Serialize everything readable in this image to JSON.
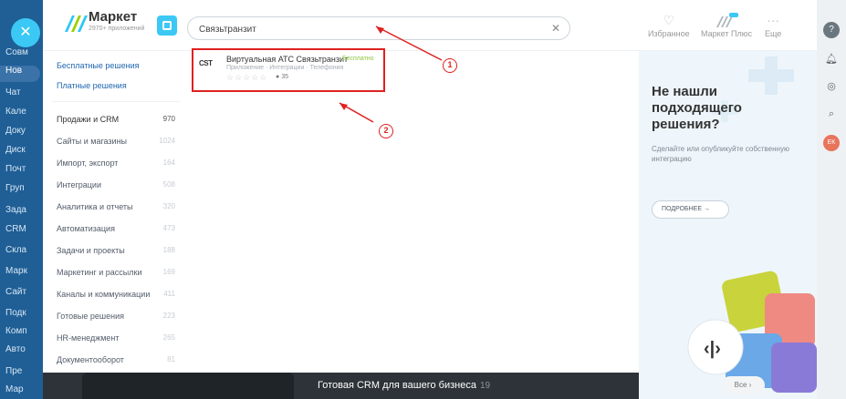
{
  "app_menu": [
    "Совм",
    "Нов",
    "Чат",
    "Кале",
    "Доку",
    "Диск",
    "Почт",
    "Груп",
    "Зада",
    "CRM",
    "Скла",
    "Марк",
    "Сайт",
    "Подк",
    "Комп",
    "Авто",
    "Пре",
    "Мар"
  ],
  "app_menu_active": 1,
  "header": {
    "logo_title": "Маркет",
    "logo_sub": "2970+ приложений",
    "search_value": "Связьтранзит",
    "links": [
      {
        "label": "Избранное",
        "icon": "heart-icon"
      },
      {
        "label": "Маркет Плюс",
        "icon": "market-plus-icon"
      },
      {
        "label": "Еще",
        "icon": "more-icon"
      }
    ]
  },
  "sidebar": {
    "links": [
      "Бесплатные решения",
      "Платные решения"
    ],
    "categories": [
      {
        "label": "Продажи и CRM",
        "count": "970"
      },
      {
        "label": "Сайты и магазины",
        "count": "1024"
      },
      {
        "label": "Импорт, экспорт",
        "count": "164"
      },
      {
        "label": "Интеграции",
        "count": "508"
      },
      {
        "label": "Аналитика и отчеты",
        "count": "320"
      },
      {
        "label": "Автоматизация",
        "count": "473"
      },
      {
        "label": "Задачи и проекты",
        "count": "188"
      },
      {
        "label": "Маркетинг и рассылки",
        "count": "169"
      },
      {
        "label": "Каналы и коммуникации",
        "count": "411"
      },
      {
        "label": "Готовые решения",
        "count": "223"
      },
      {
        "label": "HR-менеджмент",
        "count": "265"
      },
      {
        "label": "Документооборот",
        "count": "81"
      }
    ]
  },
  "result": {
    "logo_text": "CST",
    "name": "Виртуальная АТС Связьтранзит",
    "price": "Бесплатно",
    "tags": "Приложение · Интеграции · Телефония",
    "stars": "☆☆☆☆☆",
    "installs": "35"
  },
  "annotations": [
    "1",
    "2"
  ],
  "promo": {
    "title": "Не нашли подходящего решения?",
    "text": "Сделайте или опубликуйте собственную интеграцию",
    "button": "ПОДРОБНЕЕ"
  },
  "banner": {
    "text": "Готовая CRM для вашего бизнеса",
    "count": "19",
    "all_button": "Все"
  },
  "user": {
    "initials": "ЕК"
  },
  "colors": {
    "accent": "#3bc8f5",
    "annotation": "#e02020",
    "free_badge": "#8cc63f"
  }
}
